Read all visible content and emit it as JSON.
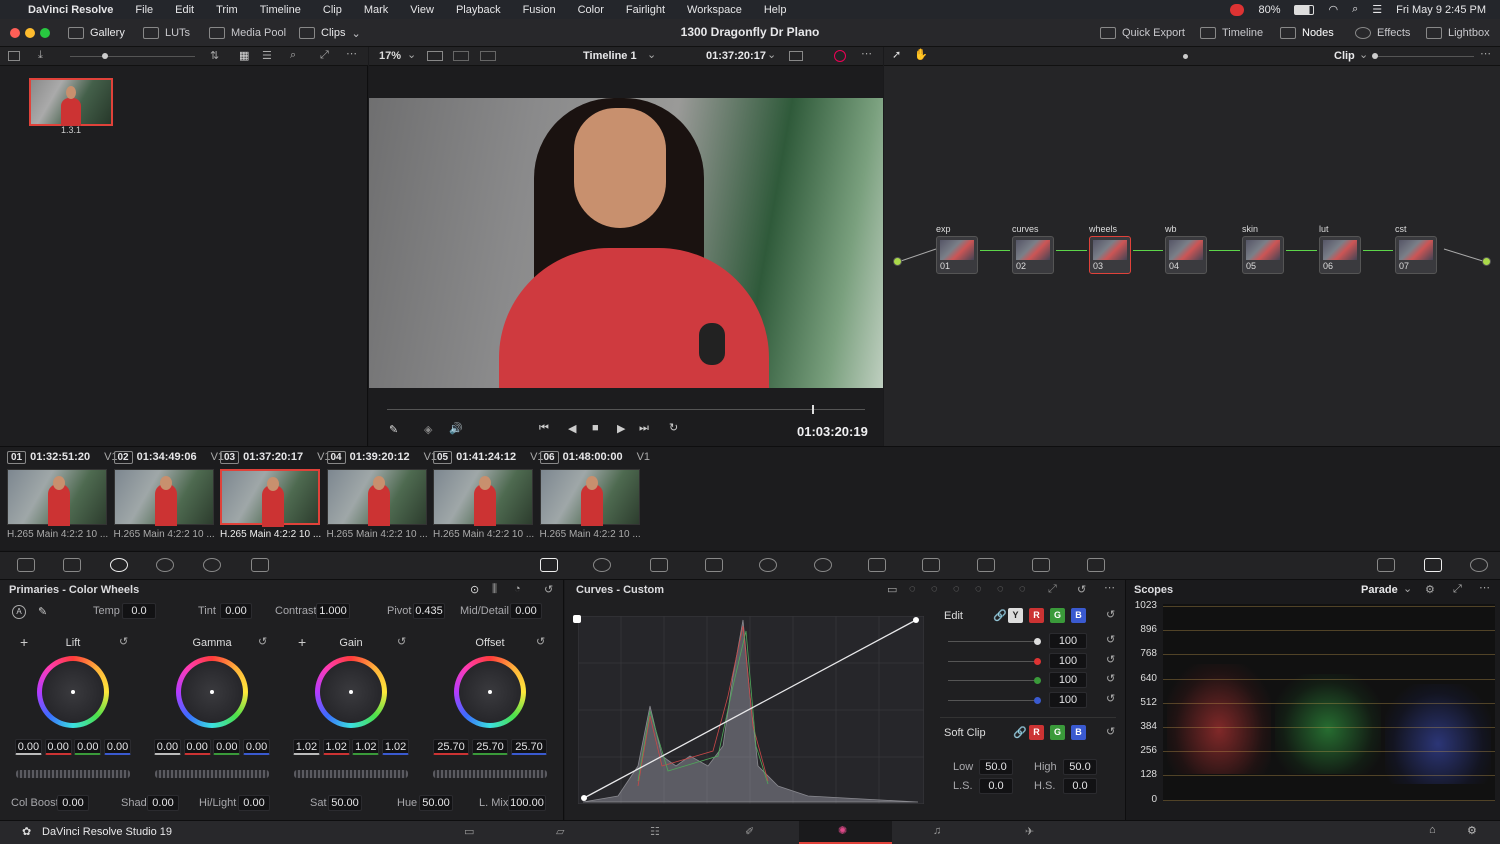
{
  "menubar": {
    "app_name": "DaVinci Resolve",
    "items": [
      "File",
      "Edit",
      "Trim",
      "Timeline",
      "Clip",
      "Mark",
      "View",
      "Playback",
      "Fusion",
      "Color",
      "Fairlight",
      "Workspace",
      "Help"
    ],
    "battery": "80%",
    "clock": "Fri May 9  2:45 PM"
  },
  "toolbar": {
    "gallery": "Gallery",
    "luts": "LUTs",
    "media_pool": "Media Pool",
    "clips": "Clips",
    "project_name": "1300 Dragonfly Dr Plano",
    "quick_export": "Quick Export",
    "timeline": "Timeline",
    "nodes": "Nodes",
    "effects": "Effects",
    "lightbox": "Lightbox"
  },
  "viewer_bar": {
    "zoom": "17%",
    "timeline_name": "Timeline 1",
    "timecode": "01:37:20:17",
    "clip_mode": "Clip"
  },
  "gallery": {
    "still_label": "1.3.1"
  },
  "viewer": {
    "playhead_timecode": "01:03:20:19",
    "scrub_position": 0.89
  },
  "nodes": [
    {
      "label": "exp",
      "num": "01"
    },
    {
      "label": "curves",
      "num": "02"
    },
    {
      "label": "wheels",
      "num": "03"
    },
    {
      "label": "wb",
      "num": "04"
    },
    {
      "label": "skin",
      "num": "05"
    },
    {
      "label": "lut",
      "num": "06"
    },
    {
      "label": "cst",
      "num": "07"
    }
  ],
  "clips": [
    {
      "num": "01",
      "tc": "01:32:51:20",
      "track": "V1",
      "codec": "H.265 Main 4:2:2 10 ..."
    },
    {
      "num": "02",
      "tc": "01:34:49:06",
      "track": "V1",
      "codec": "H.265 Main 4:2:2 10 ..."
    },
    {
      "num": "03",
      "tc": "01:37:20:17",
      "track": "V1",
      "codec": "H.265 Main 4:2:2 10 ..."
    },
    {
      "num": "04",
      "tc": "01:39:20:12",
      "track": "V1",
      "codec": "H.265 Main 4:2:2 10 ..."
    },
    {
      "num": "05",
      "tc": "01:41:24:12",
      "track": "V1",
      "codec": "H.265 Main 4:2:2 10 ..."
    },
    {
      "num": "06",
      "tc": "01:48:00:00",
      "track": "V1",
      "codec": "H.265 Main 4:2:2 10 ..."
    }
  ],
  "primaries": {
    "title": "Primaries - Color Wheels",
    "temp_label": "Temp",
    "temp": "0.0",
    "tint_label": "Tint",
    "tint": "0.00",
    "contrast_label": "Contrast",
    "contrast": "1.000",
    "pivot_label": "Pivot",
    "pivot": "0.435",
    "middetail_label": "Mid/Detail",
    "middetail": "0.00",
    "wheels": [
      {
        "name": "Lift",
        "values": [
          "0.00",
          "0.00",
          "0.00",
          "0.00"
        ]
      },
      {
        "name": "Gamma",
        "values": [
          "0.00",
          "0.00",
          "0.00",
          "0.00"
        ]
      },
      {
        "name": "Gain",
        "values": [
          "1.02",
          "1.02",
          "1.02",
          "1.02"
        ]
      },
      {
        "name": "Offset",
        "values": [
          "25.70",
          "25.70",
          "25.70"
        ]
      }
    ],
    "colboost_label": "Col Boost",
    "colboost": "0.00",
    "shad_label": "Shad",
    "shad": "0.00",
    "hilight_label": "Hi/Light",
    "hilight": "0.00",
    "sat_label": "Sat",
    "sat": "50.00",
    "hue_label": "Hue",
    "hue": "50.00",
    "lmix_label": "L. Mix",
    "lmix": "100.00"
  },
  "curves": {
    "title": "Curves - Custom",
    "edit_label": "Edit",
    "channel_buttons": [
      "Y",
      "R",
      "G",
      "B"
    ],
    "intensities": [
      "100",
      "100",
      "100",
      "100"
    ],
    "softclip_label": "Soft Clip",
    "low_label": "Low",
    "low": "50.0",
    "high_label": "High",
    "high": "50.0",
    "ls_label": "L.S.",
    "ls": "0.0",
    "hs_label": "H.S.",
    "hs": "0.0"
  },
  "scopes": {
    "title": "Scopes",
    "mode": "Parade",
    "scale": [
      "1023",
      "896",
      "768",
      "640",
      "512",
      "384",
      "256",
      "128",
      "0"
    ]
  },
  "footer": {
    "product": "DaVinci Resolve Studio 19"
  },
  "colors": {
    "accent_red": "#e0423a",
    "node_selected": "#e0423a",
    "link_green": "#5dd64a"
  }
}
